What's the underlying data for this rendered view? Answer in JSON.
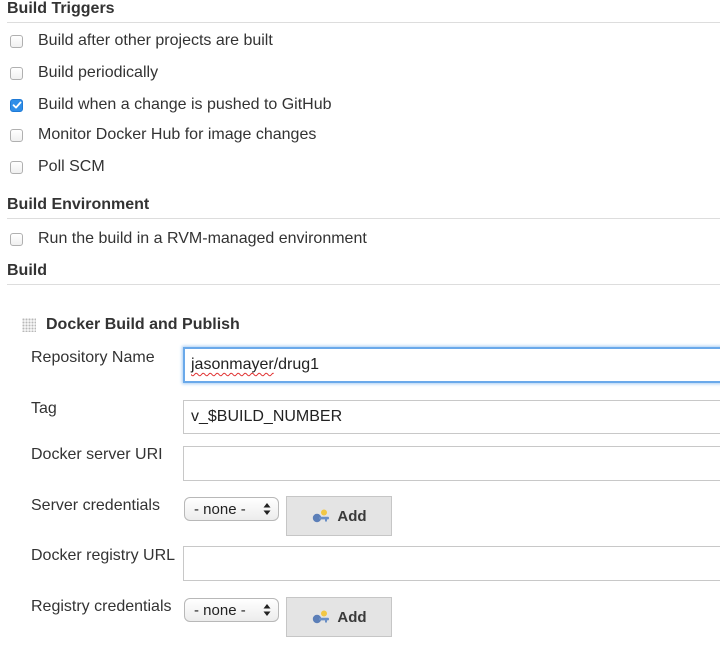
{
  "build_triggers": {
    "title": "Build Triggers",
    "options": [
      {
        "label": "Build after other projects are built",
        "checked": false
      },
      {
        "label": "Build periodically",
        "checked": false
      },
      {
        "label": "Build when a change is pushed to GitHub",
        "checked": true
      },
      {
        "label": "Monitor Docker Hub for image changes",
        "checked": false
      },
      {
        "label": "Poll SCM",
        "checked": false
      }
    ]
  },
  "build_environment": {
    "title": "Build Environment",
    "options": [
      {
        "label": "Run the build in a RVM-managed environment",
        "checked": false
      }
    ]
  },
  "build": {
    "title": "Build",
    "step": {
      "title": "Docker Build and Publish",
      "repository_name": {
        "label": "Repository Name",
        "value_misspelled": "jasonmayer",
        "value_rest": "/drug1"
      },
      "tag": {
        "label": "Tag",
        "value": "v_$BUILD_NUMBER"
      },
      "docker_server_uri": {
        "label": "Docker server URI",
        "value": ""
      },
      "server_credentials": {
        "label": "Server credentials",
        "selected": "- none -",
        "add_label": "Add"
      },
      "docker_registry_url": {
        "label": "Docker registry URL",
        "value": ""
      },
      "registry_credentials": {
        "label": "Registry credentials",
        "selected": "- none -",
        "add_label": "Add"
      }
    }
  },
  "colors": {
    "accent": "#2f8ee8",
    "focus_ring": "#6aa9ea",
    "header_border": "#dddddd",
    "button_bg": "#e4e4e4"
  },
  "icons": {
    "checkbox_check": "check-icon",
    "select_arrows": "updown-arrows-icon",
    "add_button": "key-icon",
    "drag_handle": "drag-handle-icon"
  }
}
